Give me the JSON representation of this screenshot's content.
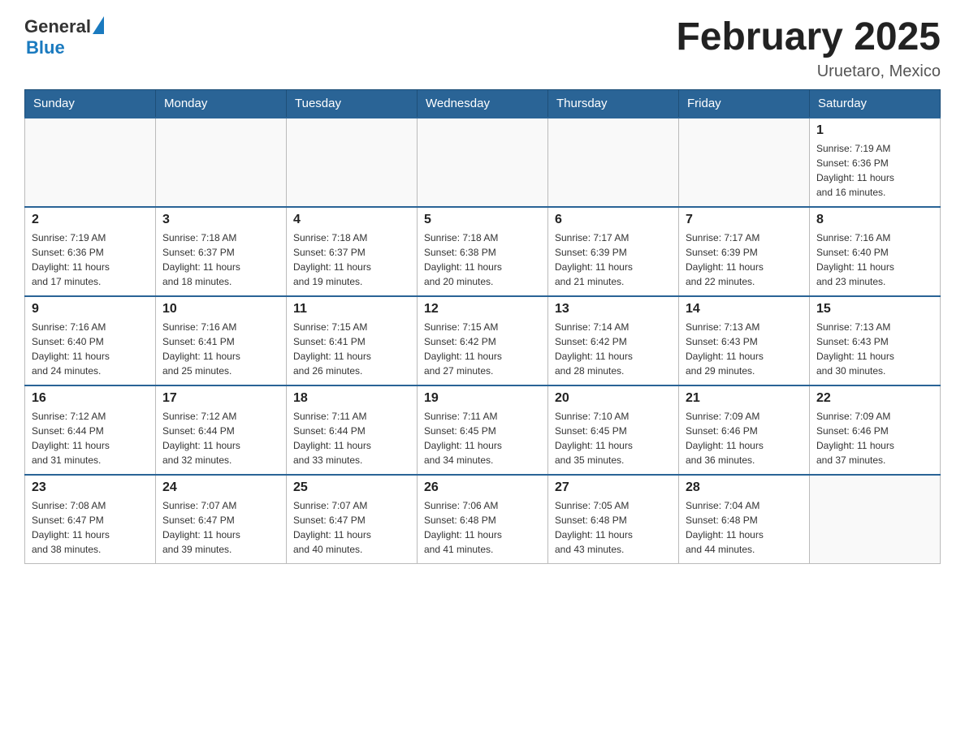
{
  "header": {
    "logo_general": "General",
    "logo_blue": "Blue",
    "month_title": "February 2025",
    "location": "Uruetaro, Mexico"
  },
  "days_of_week": [
    "Sunday",
    "Monday",
    "Tuesday",
    "Wednesday",
    "Thursday",
    "Friday",
    "Saturday"
  ],
  "weeks": [
    [
      {
        "day": "",
        "info": ""
      },
      {
        "day": "",
        "info": ""
      },
      {
        "day": "",
        "info": ""
      },
      {
        "day": "",
        "info": ""
      },
      {
        "day": "",
        "info": ""
      },
      {
        "day": "",
        "info": ""
      },
      {
        "day": "1",
        "info": "Sunrise: 7:19 AM\nSunset: 6:36 PM\nDaylight: 11 hours\nand 16 minutes."
      }
    ],
    [
      {
        "day": "2",
        "info": "Sunrise: 7:19 AM\nSunset: 6:36 PM\nDaylight: 11 hours\nand 17 minutes."
      },
      {
        "day": "3",
        "info": "Sunrise: 7:18 AM\nSunset: 6:37 PM\nDaylight: 11 hours\nand 18 minutes."
      },
      {
        "day": "4",
        "info": "Sunrise: 7:18 AM\nSunset: 6:37 PM\nDaylight: 11 hours\nand 19 minutes."
      },
      {
        "day": "5",
        "info": "Sunrise: 7:18 AM\nSunset: 6:38 PM\nDaylight: 11 hours\nand 20 minutes."
      },
      {
        "day": "6",
        "info": "Sunrise: 7:17 AM\nSunset: 6:39 PM\nDaylight: 11 hours\nand 21 minutes."
      },
      {
        "day": "7",
        "info": "Sunrise: 7:17 AM\nSunset: 6:39 PM\nDaylight: 11 hours\nand 22 minutes."
      },
      {
        "day": "8",
        "info": "Sunrise: 7:16 AM\nSunset: 6:40 PM\nDaylight: 11 hours\nand 23 minutes."
      }
    ],
    [
      {
        "day": "9",
        "info": "Sunrise: 7:16 AM\nSunset: 6:40 PM\nDaylight: 11 hours\nand 24 minutes."
      },
      {
        "day": "10",
        "info": "Sunrise: 7:16 AM\nSunset: 6:41 PM\nDaylight: 11 hours\nand 25 minutes."
      },
      {
        "day": "11",
        "info": "Sunrise: 7:15 AM\nSunset: 6:41 PM\nDaylight: 11 hours\nand 26 minutes."
      },
      {
        "day": "12",
        "info": "Sunrise: 7:15 AM\nSunset: 6:42 PM\nDaylight: 11 hours\nand 27 minutes."
      },
      {
        "day": "13",
        "info": "Sunrise: 7:14 AM\nSunset: 6:42 PM\nDaylight: 11 hours\nand 28 minutes."
      },
      {
        "day": "14",
        "info": "Sunrise: 7:13 AM\nSunset: 6:43 PM\nDaylight: 11 hours\nand 29 minutes."
      },
      {
        "day": "15",
        "info": "Sunrise: 7:13 AM\nSunset: 6:43 PM\nDaylight: 11 hours\nand 30 minutes."
      }
    ],
    [
      {
        "day": "16",
        "info": "Sunrise: 7:12 AM\nSunset: 6:44 PM\nDaylight: 11 hours\nand 31 minutes."
      },
      {
        "day": "17",
        "info": "Sunrise: 7:12 AM\nSunset: 6:44 PM\nDaylight: 11 hours\nand 32 minutes."
      },
      {
        "day": "18",
        "info": "Sunrise: 7:11 AM\nSunset: 6:44 PM\nDaylight: 11 hours\nand 33 minutes."
      },
      {
        "day": "19",
        "info": "Sunrise: 7:11 AM\nSunset: 6:45 PM\nDaylight: 11 hours\nand 34 minutes."
      },
      {
        "day": "20",
        "info": "Sunrise: 7:10 AM\nSunset: 6:45 PM\nDaylight: 11 hours\nand 35 minutes."
      },
      {
        "day": "21",
        "info": "Sunrise: 7:09 AM\nSunset: 6:46 PM\nDaylight: 11 hours\nand 36 minutes."
      },
      {
        "day": "22",
        "info": "Sunrise: 7:09 AM\nSunset: 6:46 PM\nDaylight: 11 hours\nand 37 minutes."
      }
    ],
    [
      {
        "day": "23",
        "info": "Sunrise: 7:08 AM\nSunset: 6:47 PM\nDaylight: 11 hours\nand 38 minutes."
      },
      {
        "day": "24",
        "info": "Sunrise: 7:07 AM\nSunset: 6:47 PM\nDaylight: 11 hours\nand 39 minutes."
      },
      {
        "day": "25",
        "info": "Sunrise: 7:07 AM\nSunset: 6:47 PM\nDaylight: 11 hours\nand 40 minutes."
      },
      {
        "day": "26",
        "info": "Sunrise: 7:06 AM\nSunset: 6:48 PM\nDaylight: 11 hours\nand 41 minutes."
      },
      {
        "day": "27",
        "info": "Sunrise: 7:05 AM\nSunset: 6:48 PM\nDaylight: 11 hours\nand 43 minutes."
      },
      {
        "day": "28",
        "info": "Sunrise: 7:04 AM\nSunset: 6:48 PM\nDaylight: 11 hours\nand 44 minutes."
      },
      {
        "day": "",
        "info": ""
      }
    ]
  ],
  "colors": {
    "header_bg": "#2a6496",
    "header_text": "#ffffff",
    "border": "#bbb",
    "accent": "#1a7abf"
  }
}
